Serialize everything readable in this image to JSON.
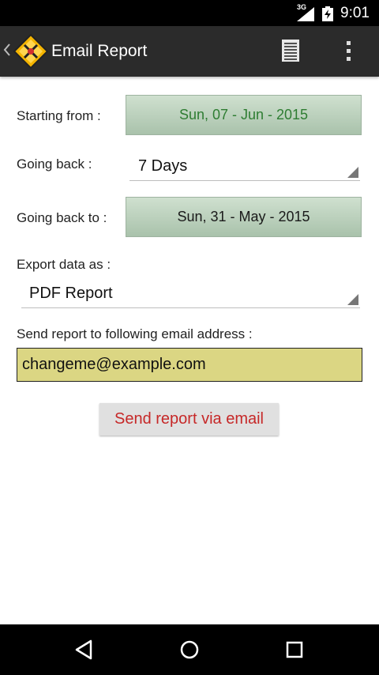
{
  "status_bar": {
    "network": "3G",
    "time": "9:01"
  },
  "action_bar": {
    "title": "Email Report"
  },
  "form": {
    "starting_from_label": "Starting from :",
    "starting_from_value": "Sun,  07 - Jun - 2015",
    "going_back_label": "Going back :",
    "going_back_value": "7 Days",
    "going_back_to_label": "Going back to :",
    "going_back_to_value": "Sun,  31 - May - 2015",
    "export_label": "Export data as :",
    "export_value": "PDF Report",
    "email_label": "Send report to following email address :",
    "email_value": "changeme@example.com",
    "send_button": "Send report via email"
  },
  "colors": {
    "start_date_text": "#2e7d32",
    "send_button_text": "#c62828",
    "email_bg": "#dbd683"
  },
  "icons": [
    "up-caret-icon",
    "app-logo-icon",
    "list-icon",
    "overflow-menu-icon",
    "back-icon",
    "home-icon",
    "recents-icon"
  ]
}
